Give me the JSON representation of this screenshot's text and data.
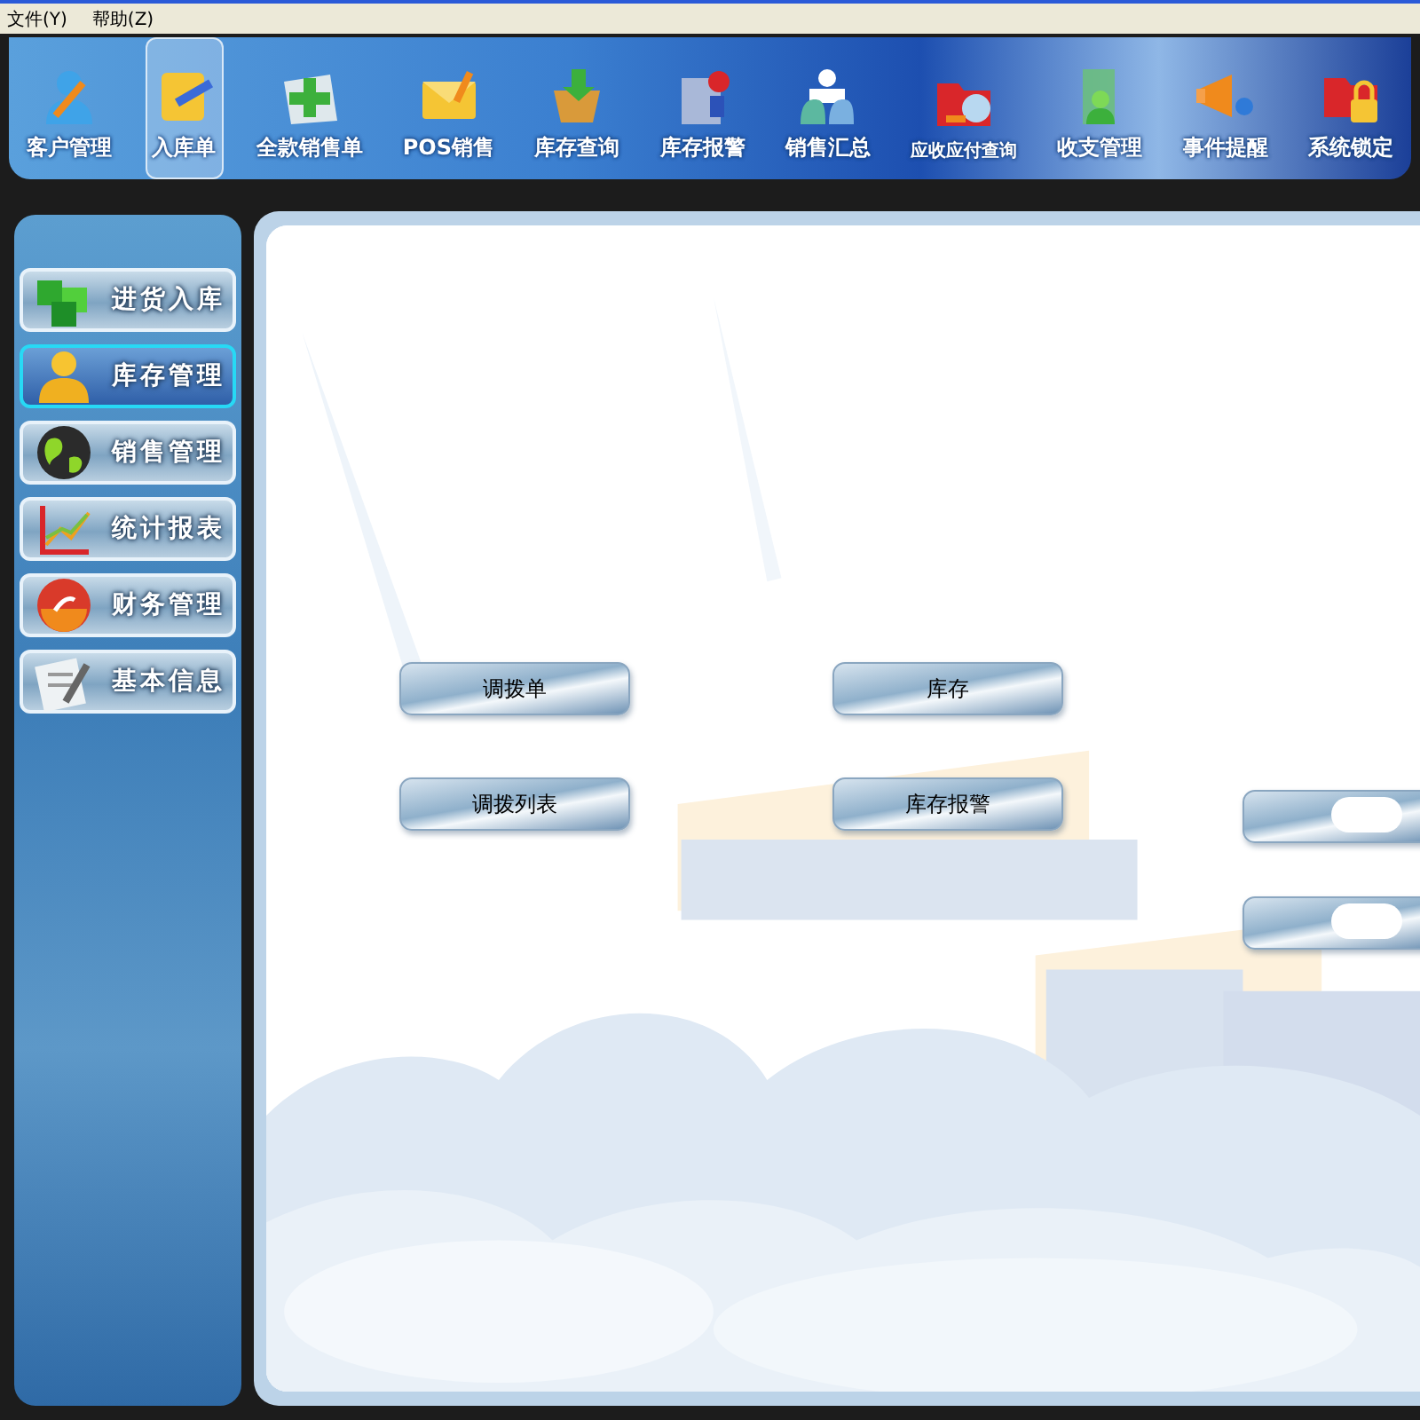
{
  "menu_bar": [
    "文件(Y)",
    "帮助(Z)"
  ],
  "toolbar": [
    {
      "label": "客户管理",
      "selected": false
    },
    {
      "label": "入库单",
      "selected": true
    },
    {
      "label": "全款销售单",
      "selected": false
    },
    {
      "label": "POS销售",
      "selected": false
    },
    {
      "label": "库存查询",
      "selected": false
    },
    {
      "label": "库存报警",
      "selected": false
    },
    {
      "label": "销售汇总",
      "selected": false
    },
    {
      "label": "应收应付查询",
      "selected": false
    },
    {
      "label": "收支管理",
      "selected": false
    },
    {
      "label": "事件提醒",
      "selected": false
    },
    {
      "label": "系统锁定",
      "selected": false
    }
  ],
  "sidebar": {
    "items": [
      {
        "label": "进货入库",
        "selected": false
      },
      {
        "label": "库存管理",
        "selected": true
      },
      {
        "label": "销售管理",
        "selected": false
      },
      {
        "label": "统计报表",
        "selected": false
      },
      {
        "label": "财务管理",
        "selected": false
      },
      {
        "label": "基本信息",
        "selected": false
      }
    ]
  },
  "content": {
    "buttons": [
      {
        "label": "调拨单"
      },
      {
        "label": "库存"
      },
      {
        "label": "调拨列表"
      },
      {
        "label": "库存报警"
      }
    ],
    "side_buttons": [
      {
        "kind": "obscured"
      },
      {
        "kind": "obscured"
      }
    ]
  }
}
